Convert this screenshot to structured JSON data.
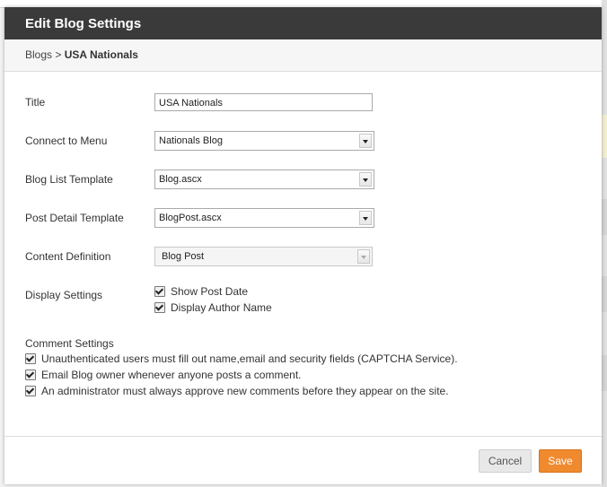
{
  "modal": {
    "title": "Edit Blog Settings",
    "breadcrumb": {
      "root": "Blogs",
      "separator": ">",
      "current": "USA Nationals"
    }
  },
  "form": {
    "title": {
      "label": "Title",
      "value": "USA Nationals"
    },
    "connect_menu": {
      "label": "Connect to Menu",
      "value": "Nationals Blog"
    },
    "list_template": {
      "label": "Blog List Template",
      "value": "Blog.ascx"
    },
    "post_template": {
      "label": "Post Detail Template",
      "value": "BlogPost.ascx"
    },
    "content_definition": {
      "label": "Content Definition",
      "value": "Blog Post"
    },
    "display_settings": {
      "label": "Display Settings",
      "options": [
        {
          "label": "Show Post Date",
          "checked": true
        },
        {
          "label": "Display Author Name",
          "checked": true
        }
      ]
    },
    "comment_settings": {
      "label": "Comment Settings",
      "options": [
        {
          "label": "Unauthenticated users must fill out name,email and security fields (CAPTCHA Service).",
          "checked": true
        },
        {
          "label": "Email Blog owner whenever anyone posts a comment.",
          "checked": true
        },
        {
          "label": "An administrator must always approve new comments before they appear on the site.",
          "checked": true
        }
      ]
    }
  },
  "footer": {
    "cancel_label": "Cancel",
    "save_label": "Save"
  },
  "colors": {
    "header_bg": "#3a3a3a",
    "save_bg": "#ef8a2f"
  }
}
